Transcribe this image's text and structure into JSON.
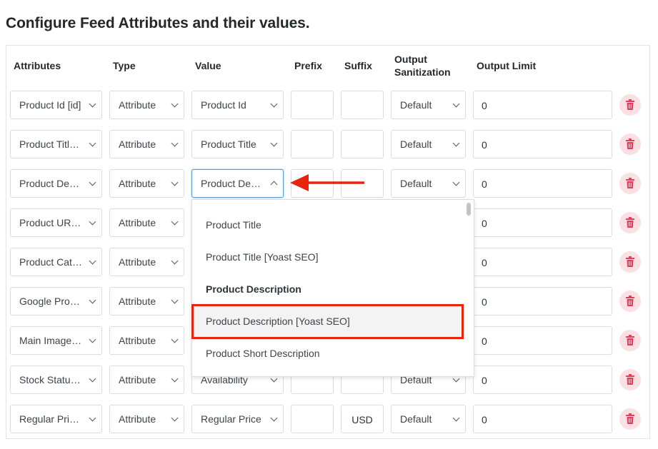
{
  "heading": "Configure Feed Attributes and their values.",
  "columns": {
    "attributes": "Attributes",
    "type": "Type",
    "value": "Value",
    "prefix": "Prefix",
    "suffix": "Suffix",
    "sanitization_line1": "Output",
    "sanitization_line2": "Sanitization",
    "limit": "Output Limit"
  },
  "rows": [
    {
      "attribute": "Product Id [id]",
      "type": "Attribute",
      "value": "Product Id",
      "prefix": "",
      "suffix": "",
      "sanitization": "Default",
      "limit": "0"
    },
    {
      "attribute": "Product Title [title]",
      "type": "Attribute",
      "value": "Product Title",
      "prefix": "",
      "suffix": "",
      "sanitization": "Default",
      "limit": "0"
    },
    {
      "attribute": "Product Description [description]",
      "type": "Attribute",
      "value": "Product Description",
      "prefix": "",
      "suffix": "",
      "sanitization": "Default",
      "limit": "0"
    },
    {
      "attribute": "Product URL [link]",
      "type": "Attribute",
      "value": "",
      "prefix": "",
      "suffix": "",
      "sanitization": "",
      "limit": "0"
    },
    {
      "attribute": "Product Categories",
      "type": "Attribute",
      "value": "",
      "prefix": "",
      "suffix": "",
      "sanitization": "",
      "limit": "0"
    },
    {
      "attribute": "Google Product Category",
      "type": "Attribute",
      "value": "",
      "prefix": "",
      "suffix": "",
      "sanitization": "",
      "limit": "0"
    },
    {
      "attribute": "Main Image [image_link]",
      "type": "Attribute",
      "value": "",
      "prefix": "",
      "suffix": "",
      "sanitization": "",
      "limit": "0"
    },
    {
      "attribute": "Stock Status [availability]",
      "type": "Attribute",
      "value": "Availability",
      "prefix": "",
      "suffix": "",
      "sanitization": "Default",
      "limit": "0"
    },
    {
      "attribute": "Regular Price [price]",
      "type": "Attribute",
      "value": "Regular Price",
      "prefix": "",
      "suffix": "USD",
      "sanitization": "Default",
      "limit": "0"
    }
  ],
  "dropdown": {
    "options": [
      {
        "label": "Product Title",
        "group": false,
        "highlighted": false
      },
      {
        "label": "Product Title [Yoast SEO]",
        "group": false,
        "highlighted": false
      },
      {
        "label": "Product Description",
        "group": true,
        "highlighted": false
      },
      {
        "label": "Product Description [Yoast SEO]",
        "group": false,
        "highlighted": true
      },
      {
        "label": "Product Short Description",
        "group": false,
        "highlighted": false
      }
    ]
  },
  "colors": {
    "annotation_red": "#e8250c",
    "delete_bg": "#fbe0e3",
    "delete_icon": "#e03f5a",
    "focus_border": "#5b9dd9"
  },
  "icons": {
    "delete": "trash-icon",
    "select": "chevron-down-icon",
    "annotation": "arrow-left-icon"
  }
}
